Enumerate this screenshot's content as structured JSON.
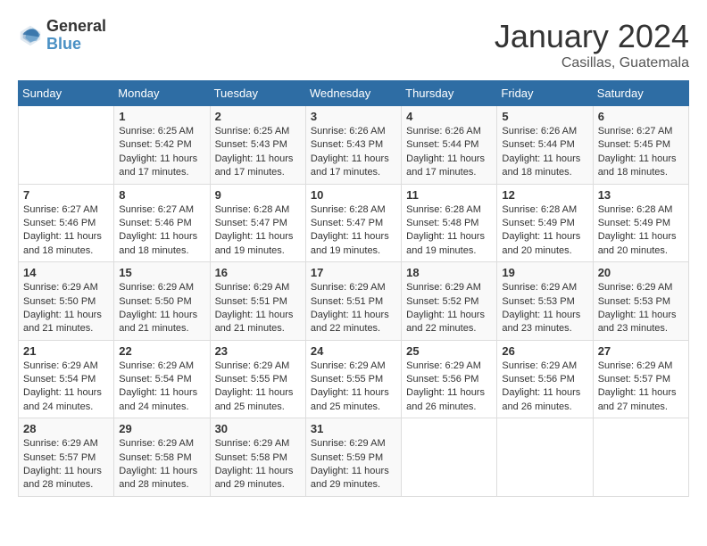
{
  "header": {
    "logo_general": "General",
    "logo_blue": "Blue",
    "month_title": "January 2024",
    "location": "Casillas, Guatemala"
  },
  "days_of_week": [
    "Sunday",
    "Monday",
    "Tuesday",
    "Wednesday",
    "Thursday",
    "Friday",
    "Saturday"
  ],
  "weeks": [
    [
      {
        "day": "",
        "sunrise": "",
        "sunset": "",
        "daylight": ""
      },
      {
        "day": "1",
        "sunrise": "Sunrise: 6:25 AM",
        "sunset": "Sunset: 5:42 PM",
        "daylight": "Daylight: 11 hours and 17 minutes."
      },
      {
        "day": "2",
        "sunrise": "Sunrise: 6:25 AM",
        "sunset": "Sunset: 5:43 PM",
        "daylight": "Daylight: 11 hours and 17 minutes."
      },
      {
        "day": "3",
        "sunrise": "Sunrise: 6:26 AM",
        "sunset": "Sunset: 5:43 PM",
        "daylight": "Daylight: 11 hours and 17 minutes."
      },
      {
        "day": "4",
        "sunrise": "Sunrise: 6:26 AM",
        "sunset": "Sunset: 5:44 PM",
        "daylight": "Daylight: 11 hours and 17 minutes."
      },
      {
        "day": "5",
        "sunrise": "Sunrise: 6:26 AM",
        "sunset": "Sunset: 5:44 PM",
        "daylight": "Daylight: 11 hours and 18 minutes."
      },
      {
        "day": "6",
        "sunrise": "Sunrise: 6:27 AM",
        "sunset": "Sunset: 5:45 PM",
        "daylight": "Daylight: 11 hours and 18 minutes."
      }
    ],
    [
      {
        "day": "7",
        "sunrise": "Sunrise: 6:27 AM",
        "sunset": "Sunset: 5:46 PM",
        "daylight": "Daylight: 11 hours and 18 minutes."
      },
      {
        "day": "8",
        "sunrise": "Sunrise: 6:27 AM",
        "sunset": "Sunset: 5:46 PM",
        "daylight": "Daylight: 11 hours and 18 minutes."
      },
      {
        "day": "9",
        "sunrise": "Sunrise: 6:28 AM",
        "sunset": "Sunset: 5:47 PM",
        "daylight": "Daylight: 11 hours and 19 minutes."
      },
      {
        "day": "10",
        "sunrise": "Sunrise: 6:28 AM",
        "sunset": "Sunset: 5:47 PM",
        "daylight": "Daylight: 11 hours and 19 minutes."
      },
      {
        "day": "11",
        "sunrise": "Sunrise: 6:28 AM",
        "sunset": "Sunset: 5:48 PM",
        "daylight": "Daylight: 11 hours and 19 minutes."
      },
      {
        "day": "12",
        "sunrise": "Sunrise: 6:28 AM",
        "sunset": "Sunset: 5:49 PM",
        "daylight": "Daylight: 11 hours and 20 minutes."
      },
      {
        "day": "13",
        "sunrise": "Sunrise: 6:28 AM",
        "sunset": "Sunset: 5:49 PM",
        "daylight": "Daylight: 11 hours and 20 minutes."
      }
    ],
    [
      {
        "day": "14",
        "sunrise": "Sunrise: 6:29 AM",
        "sunset": "Sunset: 5:50 PM",
        "daylight": "Daylight: 11 hours and 21 minutes."
      },
      {
        "day": "15",
        "sunrise": "Sunrise: 6:29 AM",
        "sunset": "Sunset: 5:50 PM",
        "daylight": "Daylight: 11 hours and 21 minutes."
      },
      {
        "day": "16",
        "sunrise": "Sunrise: 6:29 AM",
        "sunset": "Sunset: 5:51 PM",
        "daylight": "Daylight: 11 hours and 21 minutes."
      },
      {
        "day": "17",
        "sunrise": "Sunrise: 6:29 AM",
        "sunset": "Sunset: 5:51 PM",
        "daylight": "Daylight: 11 hours and 22 minutes."
      },
      {
        "day": "18",
        "sunrise": "Sunrise: 6:29 AM",
        "sunset": "Sunset: 5:52 PM",
        "daylight": "Daylight: 11 hours and 22 minutes."
      },
      {
        "day": "19",
        "sunrise": "Sunrise: 6:29 AM",
        "sunset": "Sunset: 5:53 PM",
        "daylight": "Daylight: 11 hours and 23 minutes."
      },
      {
        "day": "20",
        "sunrise": "Sunrise: 6:29 AM",
        "sunset": "Sunset: 5:53 PM",
        "daylight": "Daylight: 11 hours and 23 minutes."
      }
    ],
    [
      {
        "day": "21",
        "sunrise": "Sunrise: 6:29 AM",
        "sunset": "Sunset: 5:54 PM",
        "daylight": "Daylight: 11 hours and 24 minutes."
      },
      {
        "day": "22",
        "sunrise": "Sunrise: 6:29 AM",
        "sunset": "Sunset: 5:54 PM",
        "daylight": "Daylight: 11 hours and 24 minutes."
      },
      {
        "day": "23",
        "sunrise": "Sunrise: 6:29 AM",
        "sunset": "Sunset: 5:55 PM",
        "daylight": "Daylight: 11 hours and 25 minutes."
      },
      {
        "day": "24",
        "sunrise": "Sunrise: 6:29 AM",
        "sunset": "Sunset: 5:55 PM",
        "daylight": "Daylight: 11 hours and 25 minutes."
      },
      {
        "day": "25",
        "sunrise": "Sunrise: 6:29 AM",
        "sunset": "Sunset: 5:56 PM",
        "daylight": "Daylight: 11 hours and 26 minutes."
      },
      {
        "day": "26",
        "sunrise": "Sunrise: 6:29 AM",
        "sunset": "Sunset: 5:56 PM",
        "daylight": "Daylight: 11 hours and 26 minutes."
      },
      {
        "day": "27",
        "sunrise": "Sunrise: 6:29 AM",
        "sunset": "Sunset: 5:57 PM",
        "daylight": "Daylight: 11 hours and 27 minutes."
      }
    ],
    [
      {
        "day": "28",
        "sunrise": "Sunrise: 6:29 AM",
        "sunset": "Sunset: 5:57 PM",
        "daylight": "Daylight: 11 hours and 28 minutes."
      },
      {
        "day": "29",
        "sunrise": "Sunrise: 6:29 AM",
        "sunset": "Sunset: 5:58 PM",
        "daylight": "Daylight: 11 hours and 28 minutes."
      },
      {
        "day": "30",
        "sunrise": "Sunrise: 6:29 AM",
        "sunset": "Sunset: 5:58 PM",
        "daylight": "Daylight: 11 hours and 29 minutes."
      },
      {
        "day": "31",
        "sunrise": "Sunrise: 6:29 AM",
        "sunset": "Sunset: 5:59 PM",
        "daylight": "Daylight: 11 hours and 29 minutes."
      },
      {
        "day": "",
        "sunrise": "",
        "sunset": "",
        "daylight": ""
      },
      {
        "day": "",
        "sunrise": "",
        "sunset": "",
        "daylight": ""
      },
      {
        "day": "",
        "sunrise": "",
        "sunset": "",
        "daylight": ""
      }
    ]
  ]
}
